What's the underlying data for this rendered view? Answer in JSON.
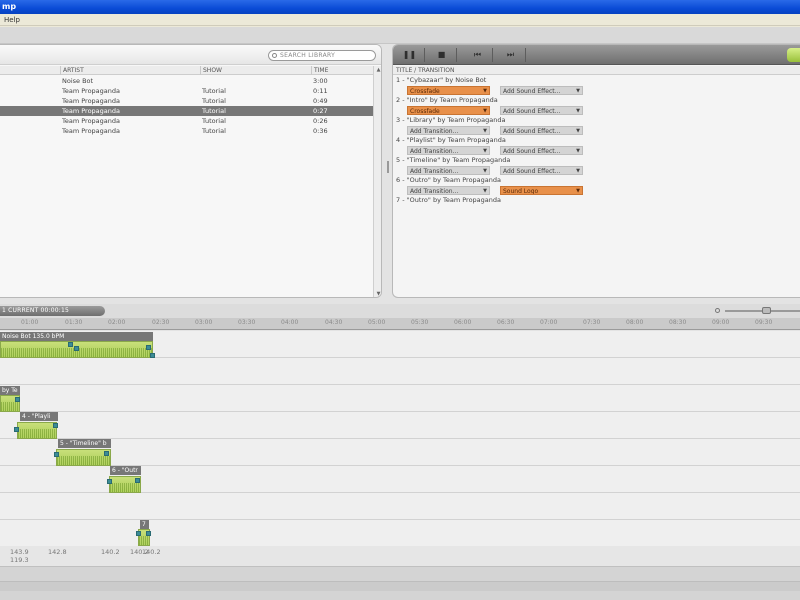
{
  "window": {
    "title": "mp"
  },
  "menu": {
    "items": [
      "Help"
    ]
  },
  "library": {
    "search_placeholder": "SEARCH LIBRARY",
    "columns": [
      "ARTIST",
      "SHOW",
      "TIME"
    ],
    "rows": [
      {
        "artist": "Noise Bot",
        "show": "",
        "time": "3:00"
      },
      {
        "artist": "Team Propaganda",
        "show": "Tutorial",
        "time": "0:11"
      },
      {
        "artist": "Team Propaganda",
        "show": "Tutorial",
        "time": "0:49"
      },
      {
        "artist": "Team Propaganda",
        "show": "Tutorial",
        "time": "0:27",
        "selected": true
      },
      {
        "artist": "Team Propaganda",
        "show": "Tutorial",
        "time": "0:26"
      },
      {
        "artist": "Team Propaganda",
        "show": "Tutorial",
        "time": "0:36"
      }
    ]
  },
  "transitions": {
    "column": "TITLE / TRANSITION",
    "items": [
      {
        "title": "1 - \"Cybazaar\" by Noise Bot",
        "transition": "Crossfade",
        "transition_active": true,
        "effect": "Add Sound Effect...",
        "effect_active": false
      },
      {
        "title": "2 - \"Intro\" by Team Propaganda",
        "transition": "Crossfade",
        "transition_active": true,
        "effect": "Add Sound Effect...",
        "effect_active": false
      },
      {
        "title": "3 - \"Library\" by Team Propaganda",
        "transition": "Add Transition...",
        "transition_active": false,
        "effect": "Add Sound Effect...",
        "effect_active": false
      },
      {
        "title": "4 - \"Playlist\" by Team Propaganda",
        "transition": "Add Transition...",
        "transition_active": false,
        "effect": "Add Sound Effect...",
        "effect_active": false
      },
      {
        "title": "5 - \"Timeline\" by Team Propaganda",
        "transition": "Add Transition...",
        "transition_active": false,
        "effect": "Add Sound Effect...",
        "effect_active": false
      },
      {
        "title": "6 - \"Outro\" by Team Propaganda",
        "transition": "Add Transition...",
        "transition_active": false,
        "effect": "Sound Logo",
        "effect_active": true
      },
      {
        "title": "7 - \"Outro\" by Team Propaganda"
      }
    ]
  },
  "timeline": {
    "current_label": "1    CURRENT 00:00:15",
    "ruler": [
      "01:00",
      "01:30",
      "02:00",
      "02:30",
      "03:00",
      "03:30",
      "04:00",
      "04:30",
      "05:00",
      "05:30",
      "06:00",
      "06:30",
      "07:00",
      "07:30",
      "08:00",
      "08:30",
      "09:00",
      "09:30"
    ],
    "clips": {
      "c1": "Noise Bot 135.0 bPM",
      "c2": "by Te",
      "c4": "4 - \"Playli",
      "c5": "5 - \"Timeline\" b",
      "c6": "6 - \"Outr",
      "c7": "7"
    },
    "bpm_labels": [
      "143.9",
      "119.3",
      "142.8",
      "140.2",
      "140.2",
      "140.2"
    ]
  },
  "colors": {
    "accent_orange": "#e8904a",
    "clip_green": "#a9cb55",
    "handle_teal": "#3c8c96"
  }
}
